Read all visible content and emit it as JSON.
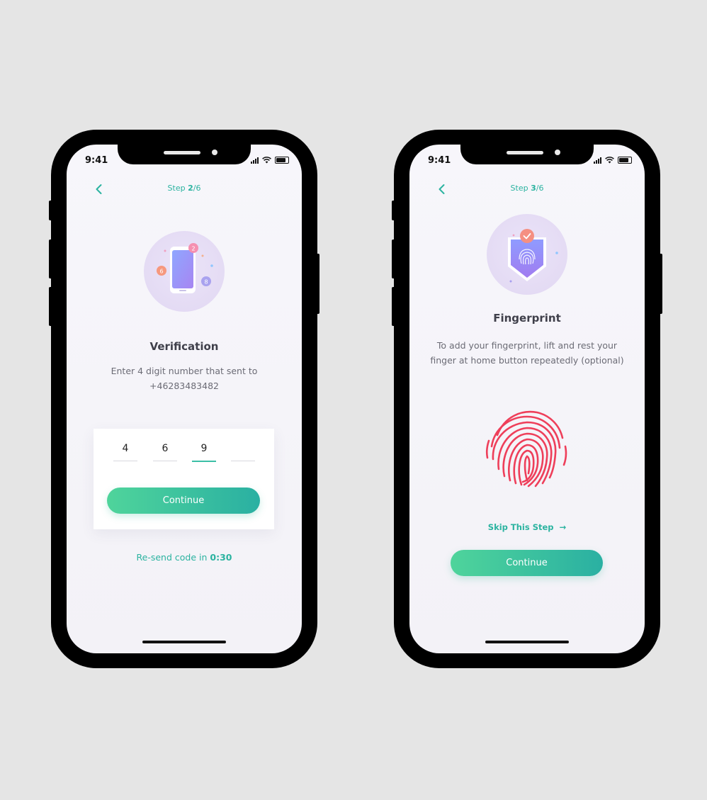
{
  "status_bar": {
    "time": "9:41"
  },
  "verification_screen": {
    "step_prefix": "Step ",
    "step_current": "2",
    "step_total": "/6",
    "title": "Verification",
    "desc_line1": "Enter 4 digit number that sent to",
    "desc_line2": "+46283483482",
    "illustration_badges": [
      "2",
      "6",
      "8"
    ],
    "digits": [
      "4",
      "6",
      "9",
      ""
    ],
    "continue_label": "Continue",
    "resend_prefix": "Re-send code in ",
    "resend_timer": "0:30"
  },
  "fingerprint_screen": {
    "step_prefix": "Step ",
    "step_current": "3",
    "step_total": "/6",
    "title": "Fingerprint",
    "desc_line1": "To add your fingerprint, lift and rest your",
    "desc_line2": "finger at home button repeatedly (optional)",
    "skip_label": "Skip This Step",
    "skip_arrow": "→",
    "continue_label": "Continue"
  },
  "colors": {
    "accent": "#2bb3a0",
    "button_start": "#4fd49b",
    "button_end": "#2ab0a2",
    "fingerprint": "#ee3f5a"
  }
}
